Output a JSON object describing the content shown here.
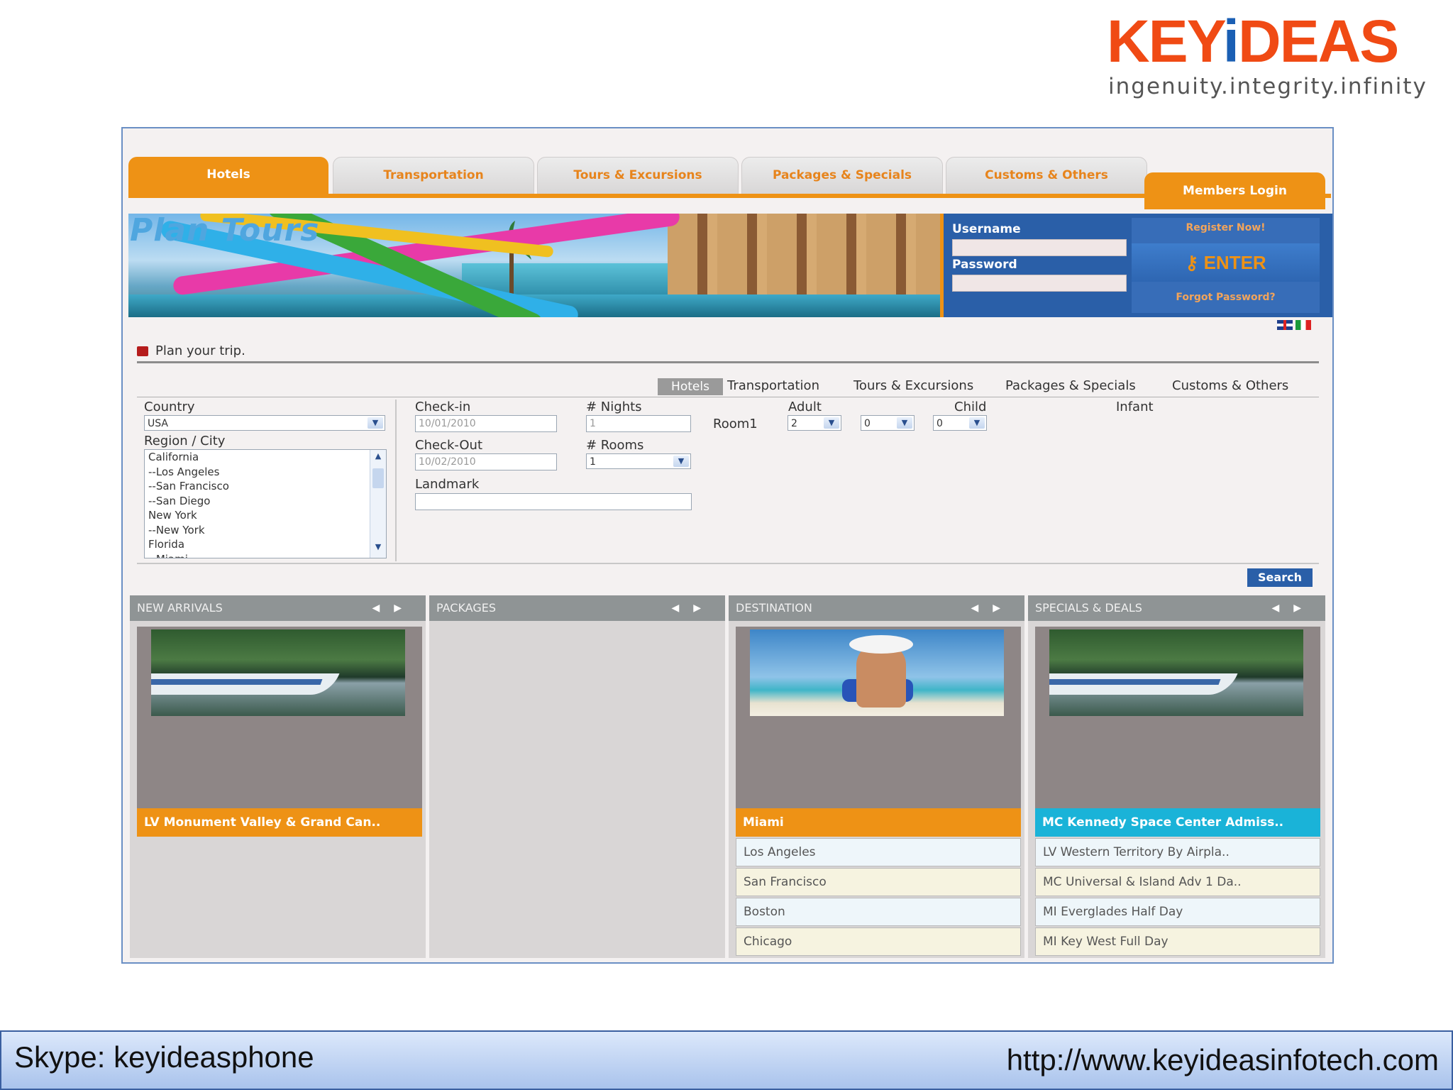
{
  "brand": {
    "logo": "KEYIDEAS",
    "tagline": "ingenuity.integrity.infinity"
  },
  "tabs": [
    {
      "label": "Hotels",
      "active": true
    },
    {
      "label": "Transportation",
      "active": false
    },
    {
      "label": "Tours & Excursions",
      "active": false
    },
    {
      "label": "Packages & Specials",
      "active": false
    },
    {
      "label": "Customs & Others",
      "active": false
    }
  ],
  "members_login": "Members Login",
  "banner": {
    "title": "Plan Tours"
  },
  "login": {
    "username_label": "Username",
    "password_label": "Password",
    "register": "Register Now!",
    "enter": "ENTER",
    "forgot": "Forgot Password?"
  },
  "plan": {
    "title": "Plan your trip.",
    "subtabs": [
      "Hotels",
      "Transportation",
      "Tours & Excursions",
      "Packages & Specials",
      "Customs & Others"
    ],
    "country_label": "Country",
    "country_value": "USA",
    "region_label": "Region / City",
    "regions": [
      "California",
      "--Los Angeles",
      "--San Francisco",
      "--San Diego",
      "New York",
      "--New York",
      "Florida",
      "--Miami"
    ],
    "checkin_label": "Check-in",
    "checkin_value": "10/01/2010",
    "checkout_label": "Check-Out",
    "checkout_value": "10/02/2010",
    "nights_label": "# Nights",
    "nights_value": "1",
    "rooms_label": "# Rooms",
    "rooms_value": "1",
    "landmark_label": "Landmark",
    "room1_label": "Room1",
    "adult_label": "Adult",
    "adult_value": "2",
    "child_label": "Child",
    "child_value": "0",
    "child_value2": "0",
    "infant_label": "Infant",
    "search": "Search"
  },
  "panels": {
    "new_arrivals": {
      "title": "NEW ARRIVALS",
      "caption": "LV Monument Valley & Grand Can.."
    },
    "packages": {
      "title": "PACKAGES"
    },
    "destination": {
      "title": "DESTINATION",
      "caption": "Miami",
      "items": [
        "Los Angeles",
        "San Francisco",
        "Boston",
        "Chicago"
      ]
    },
    "specials": {
      "title": "SPECIALS & DEALS",
      "caption": "MC Kennedy Space Center Admiss..",
      "items": [
        "LV Western Territory By Airpla..",
        "MC Universal & Island Adv 1 Da..",
        "MI Everglades Half Day",
        "MI Key West Full Day"
      ]
    }
  },
  "footer": {
    "skype": "Skype: keyideasphone",
    "url": "http://www.keyideasinfotech.com"
  },
  "colors": {
    "accent_orange": "#ee9215",
    "login_blue": "#2a5fa8",
    "brand_red": "#f04a14",
    "caption_cyan": "#1ab3d8"
  }
}
